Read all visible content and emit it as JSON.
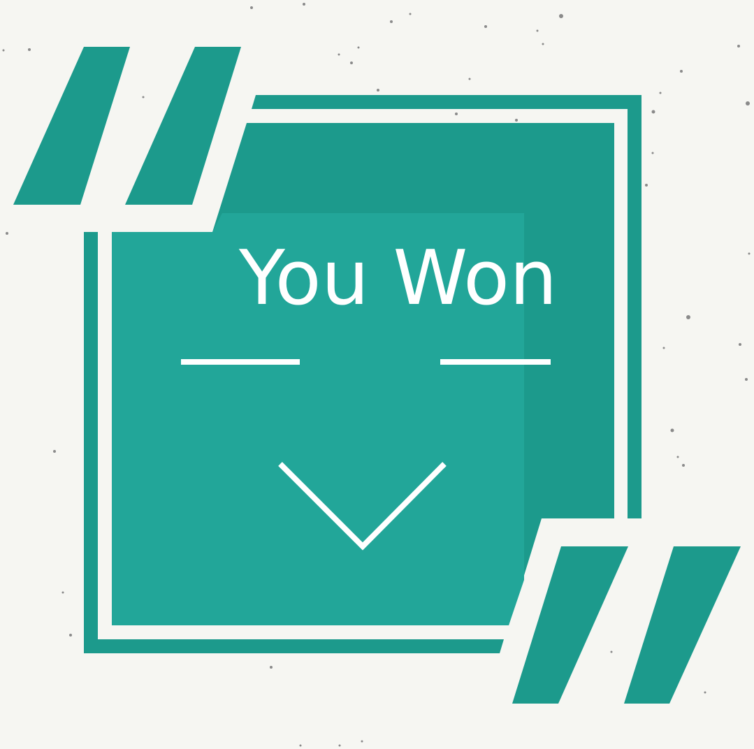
{
  "card": {
    "title": "You Won"
  },
  "colors": {
    "background": "#f6f6f2",
    "teal_dark": "#1c9a8c",
    "teal_light": "#22a699",
    "white": "#ffffff",
    "speckle": "#8a8a8a"
  },
  "icons": {
    "open_quote": "left-double-quote-icon",
    "close_quote": "right-double-quote-icon",
    "chevron": "chevron-down-icon"
  }
}
